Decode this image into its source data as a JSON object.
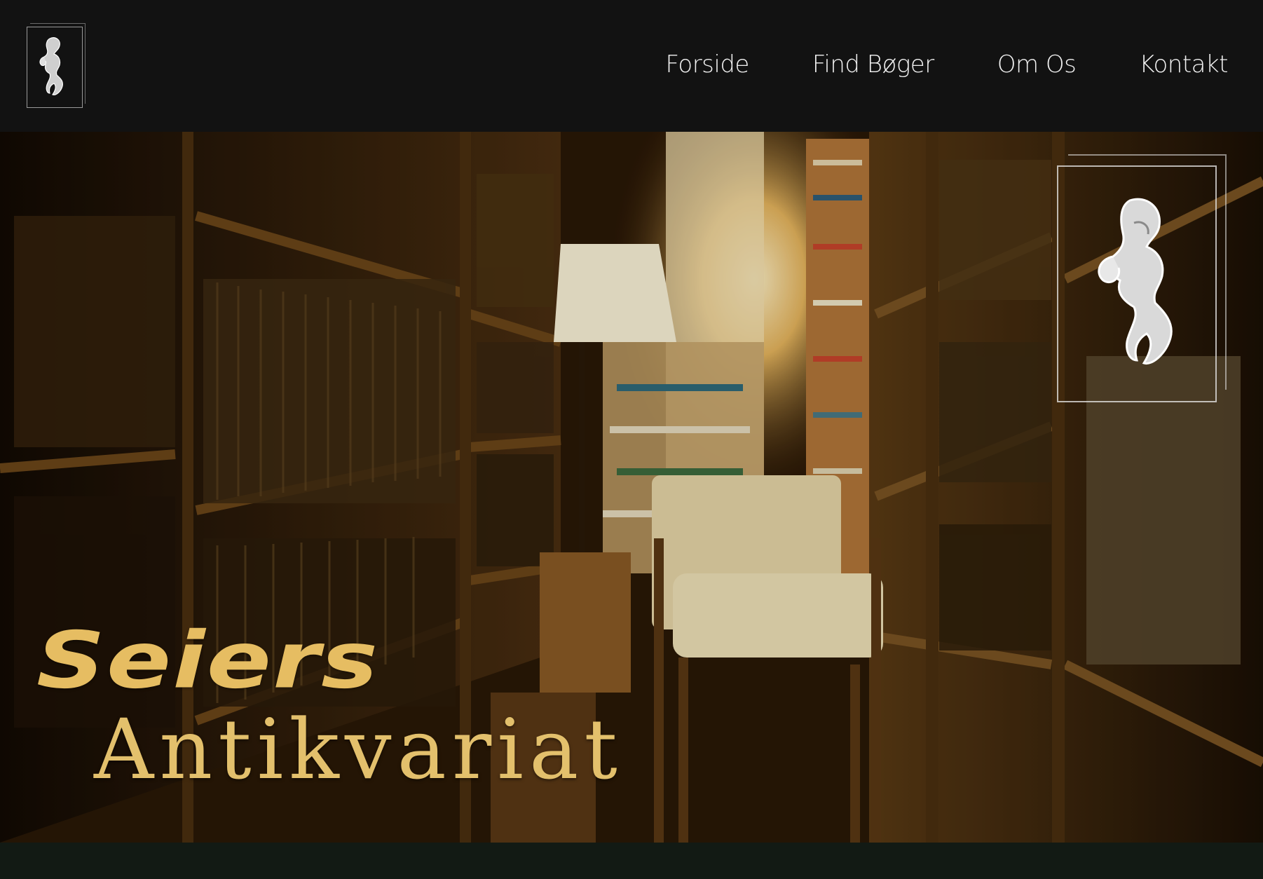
{
  "header": {
    "logo_icon": "woman-figure-logo-icon",
    "nav": [
      {
        "label": "Forside"
      },
      {
        "label": "Find Bøger"
      },
      {
        "label": "Om Os"
      },
      {
        "label": "Kontakt"
      }
    ]
  },
  "hero": {
    "title_line1": "Seiers",
    "title_line2": "Antikvariat",
    "emblem_icon": "woman-figure-logo-icon",
    "background": "bookshop-interior-photo"
  },
  "colors": {
    "header_bg": "#121212",
    "title_gold": "#e6bd62",
    "nav_text": "#f2f2f2",
    "footer_bg": "#121a14"
  }
}
